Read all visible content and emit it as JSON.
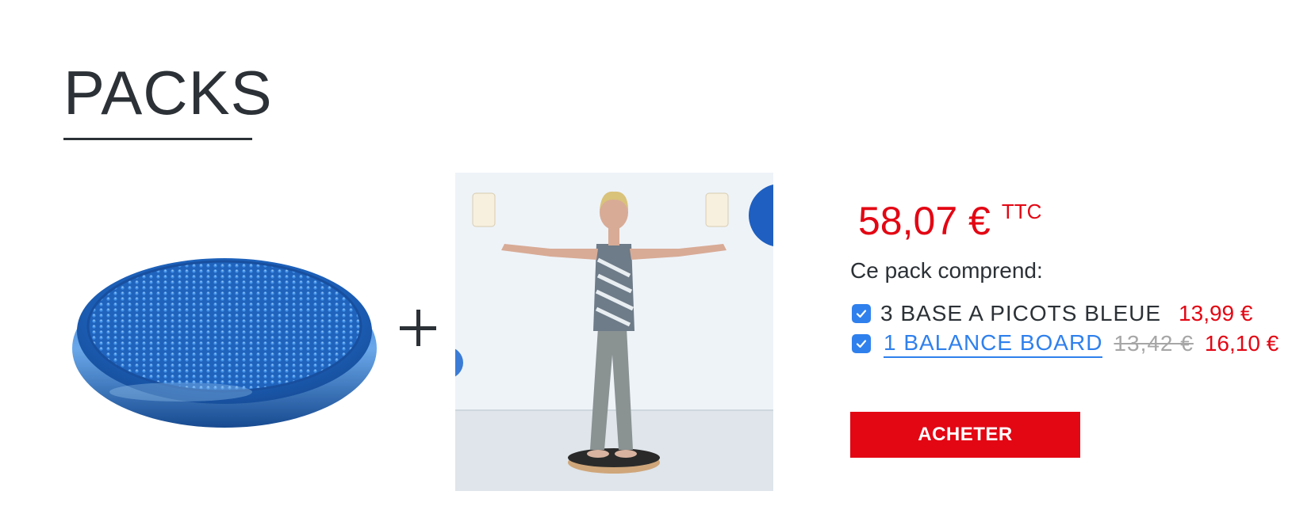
{
  "section": {
    "title": "PACKS"
  },
  "pack": {
    "total_price": "58,07 €",
    "tax_label": "TTC",
    "includes_label": "Ce pack comprend:",
    "items": [
      {
        "name": "3 BASE A PICOTS BLEUE",
        "price": "13,99 €",
        "checked": true
      },
      {
        "name": "1 BALANCE BOARD",
        "old_price": "13,42 €",
        "price": "16,10 €",
        "checked": true
      }
    ],
    "buy_label": "ACHETER"
  },
  "colors": {
    "accent": "#e30613",
    "link": "#2f80ed",
    "text": "#2b3136",
    "muted": "#a6a6a6"
  },
  "icons": [
    "plus-icon",
    "checkbox-checked-icon"
  ]
}
